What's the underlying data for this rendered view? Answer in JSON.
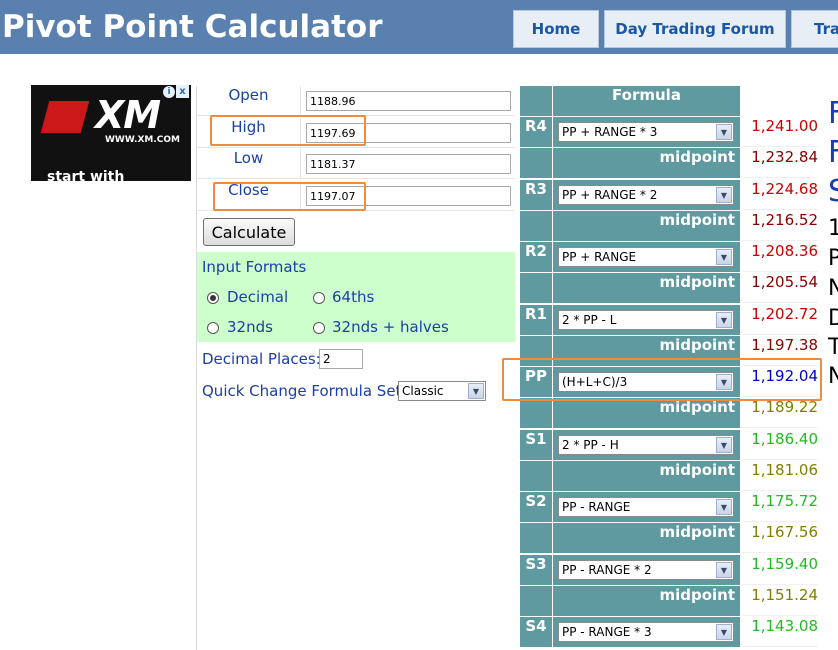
{
  "header": {
    "title": "Pivot Point Calculator",
    "tabs": [
      "Home",
      "Day Trading Forum",
      "Trac"
    ]
  },
  "ad": {
    "brand": "XM",
    "url": "WWW.XM.COM",
    "caption": "start with",
    "info_icon": "i",
    "close_icon": "x"
  },
  "inputs": {
    "open": {
      "label": "Open",
      "value": "1188.96"
    },
    "high": {
      "label": "High",
      "value": "1197.69"
    },
    "low": {
      "label": "Low",
      "value": "1181.37"
    },
    "close": {
      "label": "Close",
      "value": "1197.07"
    }
  },
  "calculate_label": "Calculate",
  "formats": {
    "title": "Input Formats",
    "options": [
      "Decimal",
      "64ths",
      "32nds",
      "32nds + halves"
    ],
    "selected": "Decimal"
  },
  "decimal_places": {
    "label": "Decimal Places:",
    "value": "2"
  },
  "quick_change": {
    "label": "Quick Change Formula Set:",
    "selected": "Classic"
  },
  "results": {
    "header": "Formula",
    "midpoint_label": "midpoint",
    "rows": [
      {
        "label": "R4",
        "formula": "PP + RANGE * 3",
        "value": "1,241.00",
        "color": "#cc0000"
      },
      {
        "mid": true,
        "value": "1,232.84",
        "color": "#880000"
      },
      {
        "label": "R3",
        "formula": "PP + RANGE * 2",
        "value": "1,224.68",
        "color": "#cc0000"
      },
      {
        "mid": true,
        "value": "1,216.52",
        "color": "#880000"
      },
      {
        "label": "R2",
        "formula": "PP + RANGE",
        "value": "1,208.36",
        "color": "#cc0000"
      },
      {
        "mid": true,
        "value": "1,205.54",
        "color": "#880000"
      },
      {
        "label": "R1",
        "formula": "2 * PP - L",
        "value": "1,202.72",
        "color": "#cc0000"
      },
      {
        "mid": true,
        "value": "1,197.38",
        "color": "#880000"
      },
      {
        "label": "PP",
        "formula": "(H+L+C)/3",
        "value": "1,192.04",
        "color": "#0000cc"
      },
      {
        "mid": true,
        "value": "1,189.22",
        "color": "#808000"
      },
      {
        "label": "S1",
        "formula": "2 * PP - H",
        "value": "1,186.40",
        "color": "#22bb22"
      },
      {
        "mid": true,
        "value": "1,181.06",
        "color": "#808000"
      },
      {
        "label": "S2",
        "formula": "PP - RANGE",
        "value": "1,175.72",
        "color": "#22bb22"
      },
      {
        "mid": true,
        "value": "1,167.56",
        "color": "#808000"
      },
      {
        "label": "S3",
        "formula": "PP - RANGE * 2",
        "value": "1,159.40",
        "color": "#22bb22"
      },
      {
        "mid": true,
        "value": "1,151.24",
        "color": "#808000"
      },
      {
        "label": "S4",
        "formula": "PP - RANGE * 3",
        "value": "1,143.08",
        "color": "#22bb22"
      }
    ]
  },
  "right_text": [
    {
      "text": "F",
      "color": "#1a3fa6"
    },
    {
      "text": "F",
      "color": "#1a3fa6"
    },
    {
      "text": "S",
      "color": "#1a3fa6"
    },
    {
      "text": "1",
      "color": "#000000"
    },
    {
      "text": "P",
      "color": "#000000"
    },
    {
      "text": "N",
      "color": "#000000"
    },
    {
      "text": "D",
      "color": "#000000"
    },
    {
      "text": "T",
      "color": "#000000"
    },
    {
      "text": "N",
      "color": "#000000"
    }
  ]
}
